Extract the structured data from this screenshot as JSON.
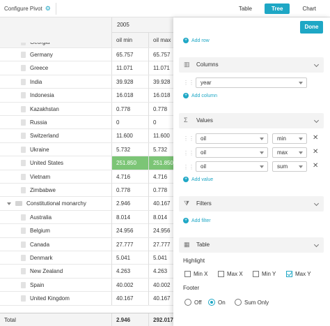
{
  "toolbar": {
    "configure_label": "Configure Pivot",
    "tabs": [
      {
        "label": "Table",
        "active": false
      },
      {
        "label": "Tree",
        "active": true
      },
      {
        "label": "Chart",
        "active": false
      }
    ]
  },
  "grid": {
    "year_header": "2005",
    "col1_header": "oil min",
    "col2_header": "oil max",
    "partial_row": "Georgia",
    "rows": [
      {
        "name": "Germany",
        "v1": "65.757",
        "v2": "65.757"
      },
      {
        "name": "Greece",
        "v1": "11.071",
        "v2": "11.071"
      },
      {
        "name": "India",
        "v1": "39.928",
        "v2": "39.928"
      },
      {
        "name": "Indonesia",
        "v1": "16.018",
        "v2": "16.018"
      },
      {
        "name": "Kazakhstan",
        "v1": "0.778",
        "v2": "0.778"
      },
      {
        "name": "Russia",
        "v1": "0",
        "v2": "0"
      },
      {
        "name": "Switzerland",
        "v1": "11.600",
        "v2": "11.600"
      },
      {
        "name": "Ukraine",
        "v1": "5.732",
        "v2": "5.732"
      },
      {
        "name": "United States",
        "v1": "251.850",
        "v2": "251.850",
        "highlight": true
      },
      {
        "name": "Vietnam",
        "v1": "4.716",
        "v2": "4.716"
      },
      {
        "name": "Zimbabwe",
        "v1": "0.778",
        "v2": "0.778"
      },
      {
        "name": "Constitutional monarchy",
        "v1": "2.946",
        "v2": "40.167",
        "group": true
      },
      {
        "name": "Australia",
        "v1": "8.014",
        "v2": "8.014"
      },
      {
        "name": "Belgium",
        "v1": "24.956",
        "v2": "24.956"
      },
      {
        "name": "Canada",
        "v1": "27.777",
        "v2": "27.777"
      },
      {
        "name": "Denmark",
        "v1": "5.041",
        "v2": "5.041"
      },
      {
        "name": "New Zealand",
        "v1": "4.263",
        "v2": "4.263"
      },
      {
        "name": "Spain",
        "v1": "40.002",
        "v2": "40.002"
      },
      {
        "name": "United Kingdom",
        "v1": "40.167",
        "v2": "40.167"
      }
    ],
    "total": {
      "label": "Total",
      "v1": "2.946",
      "v2": "292.017"
    }
  },
  "panel": {
    "done_label": "Done",
    "add_row": "Add row",
    "columns": {
      "title": "Columns",
      "field": "year",
      "add": "Add column"
    },
    "values": {
      "title": "Values",
      "items": [
        {
          "field": "oil",
          "op": "min"
        },
        {
          "field": "oil",
          "op": "max"
        },
        {
          "field": "oil",
          "op": "sum"
        }
      ],
      "add": "Add value"
    },
    "filters": {
      "title": "Filters",
      "add": "Add filter"
    },
    "table": {
      "title": "Table",
      "highlight_label": "Highlight",
      "highlight": [
        {
          "label": "Min X",
          "checked": false
        },
        {
          "label": "Max X",
          "checked": false
        },
        {
          "label": "Min Y",
          "checked": false
        },
        {
          "label": "Max Y",
          "checked": true
        }
      ],
      "footer_label": "Footer",
      "footer": [
        {
          "label": "Off",
          "selected": false
        },
        {
          "label": "On",
          "selected": true
        },
        {
          "label": "Sum Only",
          "selected": false
        }
      ]
    }
  },
  "colors": {
    "accent": "#1ea7c5",
    "highlight": "#7cc576"
  }
}
